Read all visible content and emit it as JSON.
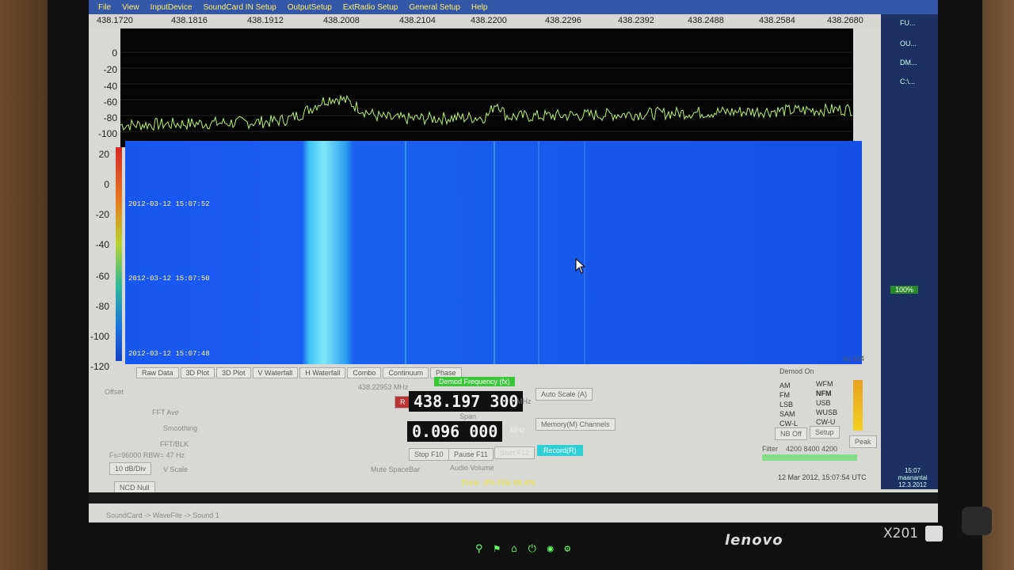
{
  "menu": [
    "File",
    "View",
    "InputDevice",
    "SoundCard IN Setup",
    "OutputSetup",
    "ExtRadio Setup",
    "General Setup",
    "Help"
  ],
  "freq_axis": [
    "438.1720",
    "438.1816",
    "438.1912",
    "438.2008",
    "438.2104",
    "438.2200",
    "438.2296",
    "438.2392",
    "438.2488",
    "438.2584",
    "438.2680"
  ],
  "spectrum_y": [
    "0",
    "-20",
    "-40",
    "-60",
    "-80",
    "-100"
  ],
  "waterfall_y": [
    "20",
    "0",
    "-20",
    "-40",
    "-60",
    "-80",
    "-100",
    "-120"
  ],
  "waterfall_timestamps": [
    "2012-03-12 15:07:52",
    "2012-03-12 15:07:50",
    "2012-03-12 15:07:48"
  ],
  "tabs": [
    "Raw Data",
    "3D Plot",
    "3D Plot",
    "V Waterfall",
    "H Waterfall",
    "Combo",
    "Continuum",
    "Phase"
  ],
  "left_panel": {
    "offset_label": "Offset",
    "fft_ave_label": "FFT Ave",
    "smoothing_label": "Smoothing",
    "fft_blk_label": "FFT/BLK",
    "rbw_label": "Fs=96000 RBW= 47 Hz",
    "v_scale_label": "V Scale",
    "v_scale_value": "10 dB/Div",
    "ncd_null": "NCD Null"
  },
  "center_panel": {
    "cursor_freq": "438.22953 MHz",
    "demod_freq_label": "Demod Frequency (fx)",
    "r_badge": "R",
    "demod_freq": "438.197 300",
    "unit_mhz": "MHz",
    "span_label": "Span",
    "span_value": "0.096 000",
    "auto_scale": "Auto Scale (A)",
    "memory_channels": "Memory(M) Channels",
    "stop": "Stop F10",
    "pause": "Pause F11",
    "start": "Start F12",
    "record": "Record(R)",
    "mute": "Mute SpaceBar",
    "audio_volume": "Audio Volume",
    "time_file": "Time .0%  File 65.4%"
  },
  "demod": {
    "demod_on_label": "Demod On",
    "modes": [
      "AM",
      "WFM",
      "FM",
      "NFM",
      "LSB",
      "USB",
      "SAM",
      "WUSB",
      "CW-L",
      "CW-U"
    ],
    "selected_mode": "NFM",
    "nb_off": "NB Off",
    "setup": "Setup",
    "peak": "Peak",
    "filter": "Filter",
    "filter_values": "4200  8400  4200",
    "sq": "sq 124"
  },
  "datetime": "12 Mar 2012, 15:07:54 UTC",
  "status_bar": "SoundCard -> WaveFile -> Sound 1",
  "taskbar": {
    "items": [
      "FU...",
      "OU...",
      "DM...",
      "C:\\..."
    ],
    "zoom": "100%",
    "clock_time": "15:07",
    "clock_day": "maanantai",
    "clock_date": "12.3.2012"
  },
  "hardware": {
    "brand": "lenovo",
    "model": "X201"
  },
  "colors": {
    "menu_bg": "#3557a8",
    "menu_text": "#ffef6a",
    "spectrum_trace": "#b8f070",
    "waterfall_base": "#1450e8",
    "waterfall_signal": "#5ad8f0",
    "lcd_bg": "#101010",
    "record_btn": "#2ed0d6"
  }
}
